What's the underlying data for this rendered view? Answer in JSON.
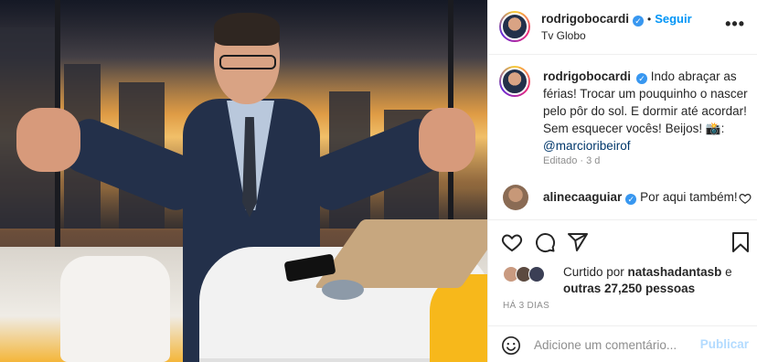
{
  "post": {
    "author": "rodrigobocardi",
    "location": "Tv Globo",
    "follow_label": "Seguir",
    "separator": "•",
    "more_label": "•••",
    "caption_lines": [
      "Indo abraçar as férias! Trocar um pouquinho o nascer pelo pôr do sol. E dormir até acordar! Sem esquecer vocês! Beijos! 📸: "
    ],
    "caption_mention": "@marcioribeirof",
    "edited": "Editado · 3 d"
  },
  "comment": {
    "author": "alinecaaguiar",
    "text": "Por aqui também!"
  },
  "likes": {
    "text_prefix": "Curtido por ",
    "liker": "natashadantasb",
    "text_mid": " e ",
    "others": "outras 27,250 pessoas"
  },
  "timestamp": "HÁ 3 DIAS",
  "add_comment": {
    "placeholder": "Adicione um comentário...",
    "publish_label": "Publicar"
  },
  "colors": {
    "accent": "#0095f6",
    "verified": "#3897f0",
    "muted": "#8e8e8e",
    "publish_disabled": "#b3dbff"
  }
}
